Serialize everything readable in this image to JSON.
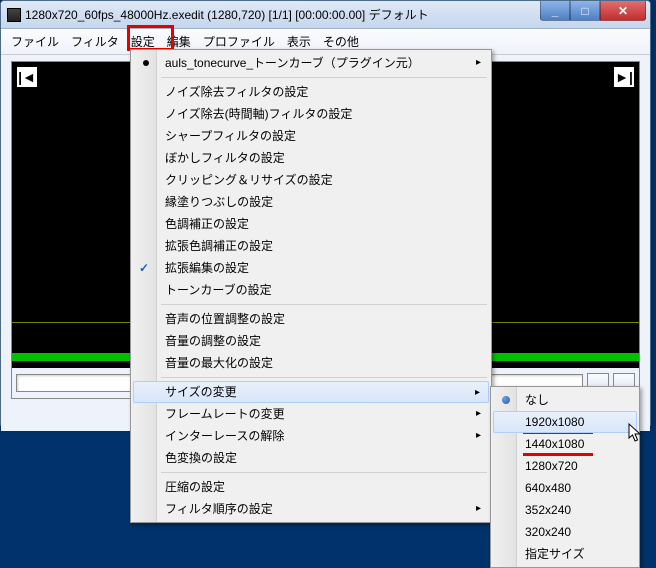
{
  "title": "1280x720_60fps_48000Hz.exedit (1280,720)  [1/1]  [00:00:00.00]  デフォルト",
  "menubar": [
    "ファイル",
    "フィルタ",
    "設定",
    "編集",
    "プロファイル",
    "表示",
    "その他"
  ],
  "menu1": {
    "items": [
      {
        "label": "auls_tonecurve_トーンカーブ（プラグイン元）",
        "bullet": true,
        "sub": true,
        "sep_after": true
      },
      {
        "label": "ノイズ除去フィルタの設定"
      },
      {
        "label": "ノイズ除去(時間軸)フィルタの設定"
      },
      {
        "label": "シャープフィルタの設定"
      },
      {
        "label": "ぼかしフィルタの設定"
      },
      {
        "label": "クリッピング＆リサイズの設定"
      },
      {
        "label": "縁塗りつぶしの設定"
      },
      {
        "label": "色調補正の設定"
      },
      {
        "label": "拡張色調補正の設定"
      },
      {
        "label": "拡張編集の設定",
        "checked": true
      },
      {
        "label": "トーンカーブの設定",
        "sep_after": true
      },
      {
        "label": "音声の位置調整の設定"
      },
      {
        "label": "音量の調整の設定"
      },
      {
        "label": "音量の最大化の設定",
        "sep_after": true
      },
      {
        "label": "サイズの変更",
        "sub": true,
        "highlight": true
      },
      {
        "label": "フレームレートの変更",
        "sub": true
      },
      {
        "label": "インターレースの解除",
        "sub": true
      },
      {
        "label": "色変換の設定",
        "sep_after": true
      },
      {
        "label": "圧縮の設定"
      },
      {
        "label": "フィルタ順序の設定",
        "sub": true
      }
    ]
  },
  "menu2": {
    "items": [
      {
        "label": "なし",
        "radio": true
      },
      {
        "label": "1920x1080",
        "highlight": true,
        "underline": true
      },
      {
        "label": "1440x1080",
        "underline": true
      },
      {
        "label": "1280x720"
      },
      {
        "label": "640x480"
      },
      {
        "label": "352x240"
      },
      {
        "label": "320x240"
      },
      {
        "label": "指定サイズ"
      }
    ]
  }
}
